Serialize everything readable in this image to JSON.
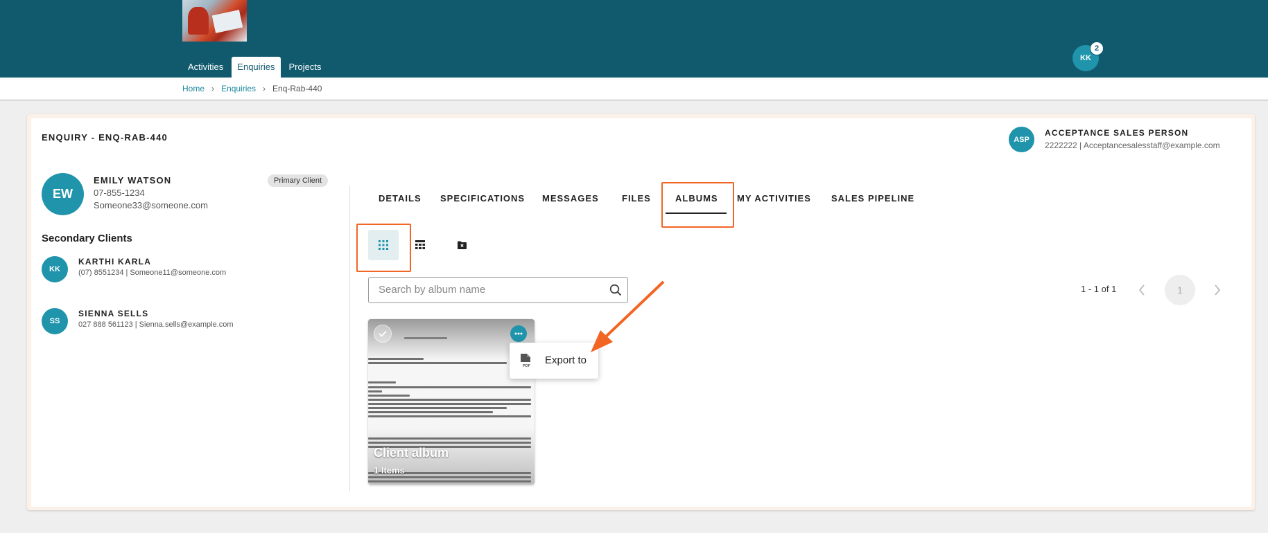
{
  "header": {
    "nav": [
      "Activities",
      "Enquiries",
      "Projects"
    ],
    "active_nav": "Enquiries",
    "user_initials": "KK",
    "notification_count": "2"
  },
  "breadcrumb": {
    "items": [
      "Home",
      "Enquiries",
      "Enq-Rab-440"
    ]
  },
  "enquiry": {
    "title": "ENQUIRY - ENQ-RAB-440"
  },
  "sales_person": {
    "initials": "ASP",
    "name": "ACCEPTANCE SALES PERSON",
    "phone": "2222222",
    "email": "Acceptancesalesstaff@example.com",
    "contact_line": "2222222  |  Acceptancesalesstaff@example.com"
  },
  "primary_client": {
    "initials": "EW",
    "name": "EMILY WATSON",
    "phone": "07-855-1234",
    "email": "Someone33@someone.com",
    "chip": "Primary Client"
  },
  "secondary_clients": {
    "title": "Secondary Clients",
    "items": [
      {
        "initials": "KK",
        "name": "KARTHI KARLA",
        "contact_line": "(07) 8551234  |  Someone11@someone.com"
      },
      {
        "initials": "SS",
        "name": "SIENNA SELLS",
        "contact_line": "027 888 561123  |  Sienna.sells@example.com"
      }
    ]
  },
  "tabs": {
    "items": [
      "DETAILS",
      "SPECIFICATIONS",
      "MESSAGES",
      "FILES",
      "ALBUMS",
      "MY ACTIVITIES",
      "SALES PIPELINE"
    ],
    "active": "ALBUMS"
  },
  "albums": {
    "search_placeholder": "Search by album name",
    "pager_text": "1 - 1 of 1",
    "current_page": "1",
    "cards": [
      {
        "title": "Client album",
        "count": "1 Items"
      }
    ],
    "menu": {
      "items": [
        "Export to"
      ]
    }
  },
  "colors": {
    "header": "#115a6e",
    "accent": "#1f94ab",
    "highlight": "#f26522"
  },
  "icons": {
    "grid_view": "grid-view-icon",
    "list_view": "table-view-icon",
    "folder": "folder-x-icon",
    "search": "search-icon",
    "pdf": "pdf-icon",
    "more": "more-horizontal-icon"
  }
}
